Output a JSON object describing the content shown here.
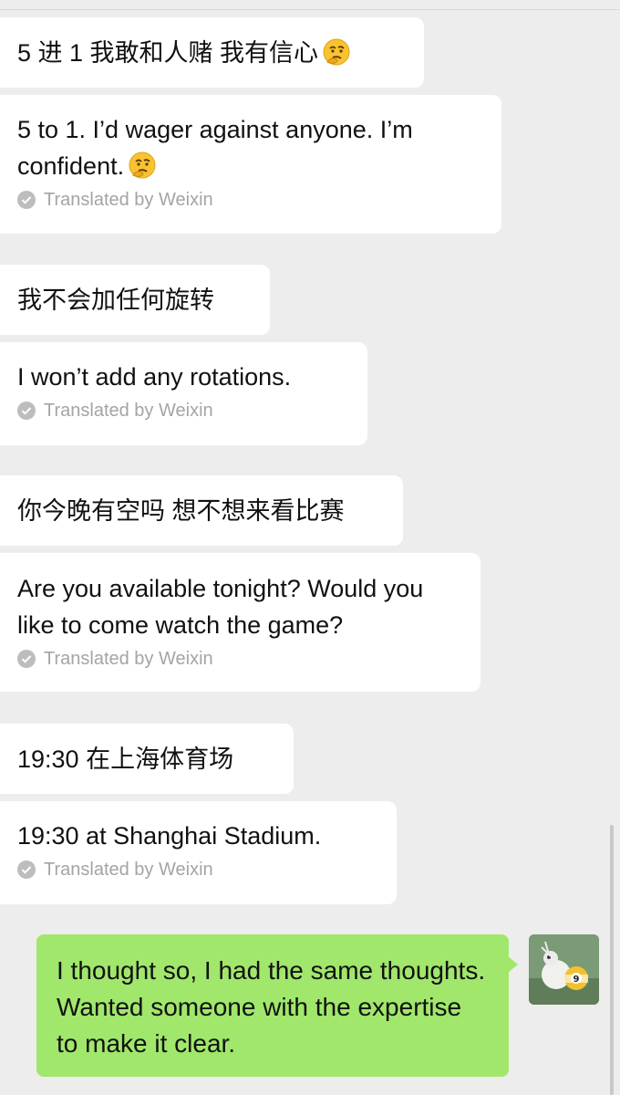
{
  "messages": [
    {
      "original": "5 进 1 我敢和人赌 我有信心",
      "translation": "5 to 1. I’d wager against anyone. I’m confident.",
      "translated_by": "Translated by Weixin",
      "emoji": "thinking-face-icon"
    },
    {
      "original": "我不会加任何旋转",
      "translation": "I won’t add any rotations.",
      "translated_by": "Translated by Weixin"
    },
    {
      "original": "你今晚有空吗 想不想来看比赛",
      "translation": "Are you available tonight? Would you like to come watch the game?",
      "translated_by": "Translated by Weixin"
    },
    {
      "original": "19:30 在上海体育场",
      "translation": "19:30 at Shanghai Stadium.",
      "translated_by": "Translated by Weixin"
    }
  ],
  "my_message": {
    "text": "I thought so, I had the same thoughts. Wanted someone with the expertise to make it clear."
  },
  "avatar": {
    "icon": "billiard-ball-avatar-icon",
    "ball_number": "9"
  },
  "colors": {
    "background": "#ededed",
    "incoming_bubble": "#ffffff",
    "outgoing_bubble": "#a0e76b",
    "translated_note": "#a4a4a4"
  }
}
